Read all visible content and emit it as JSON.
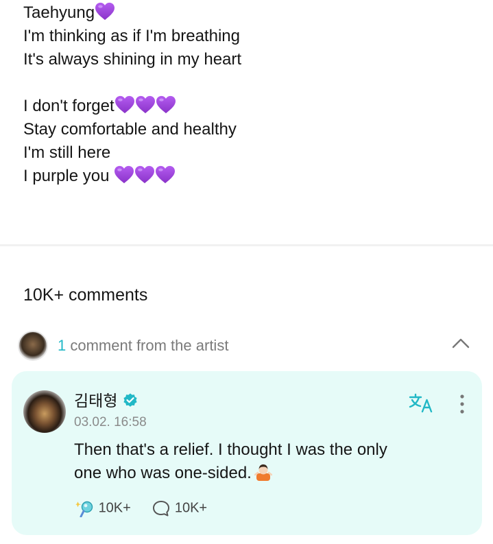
{
  "post": {
    "lines": [
      "Taehyung",
      "I'm thinking as if I'm breathing",
      "It's always shining in my heart",
      "",
      "I don't forget",
      "Stay comfortable and healthy",
      "I'm still here",
      "I purple you "
    ]
  },
  "comments": {
    "count_label": "10K+ comments"
  },
  "artist_comments": {
    "count": "1",
    "label": " comment from the artist",
    "collapse_icon": "chevron-up-icon"
  },
  "comment": {
    "author": "김태형",
    "verified_icon": "verified-badge-icon",
    "time": "03.02. 16:58",
    "text_lines": [
      "Then that's a relief. I thought I was the only",
      "one who was one-sided."
    ],
    "likes": "10K+",
    "replies": "10K+",
    "translate_icon": "translate-icon",
    "more_icon": "more-vertical-icon"
  },
  "colors": {
    "accent": "#21b8c6",
    "card_bg": "#e6fbf8",
    "heart": "#a447e0"
  }
}
